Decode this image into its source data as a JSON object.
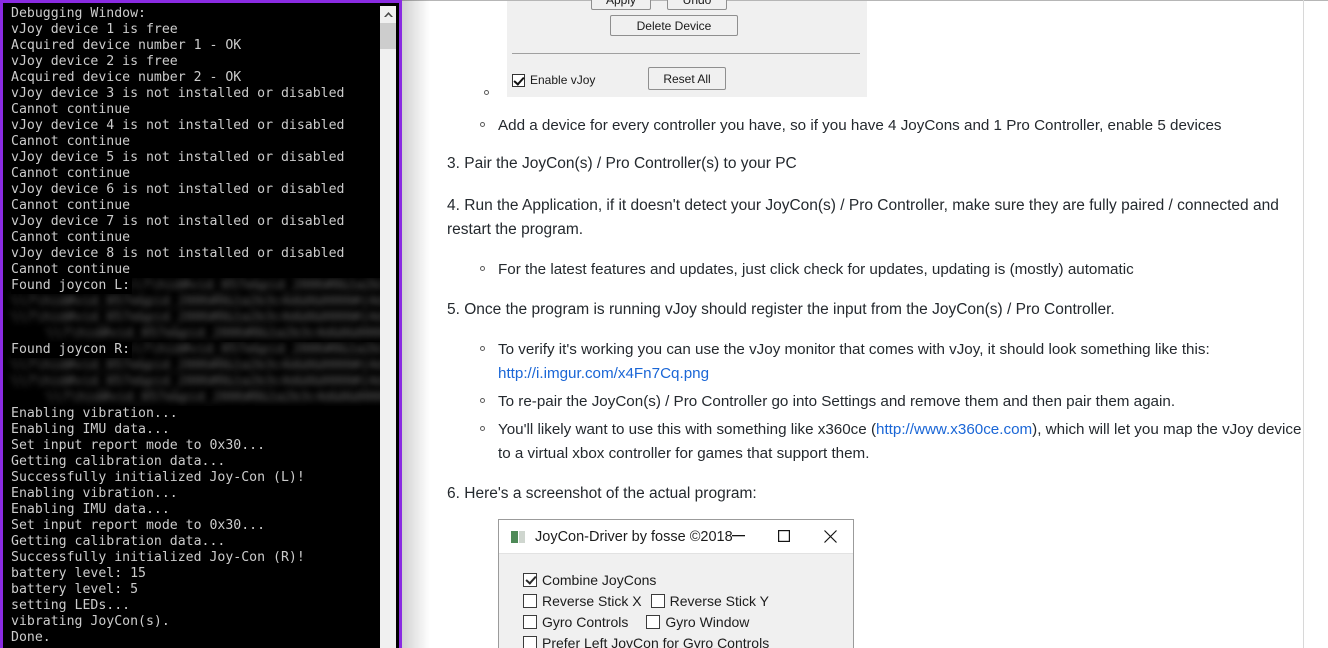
{
  "console": {
    "window_name": "Debugging Window",
    "lines": [
      "Debugging Window:",
      "vJoy device 1 is free",
      "Acquired device number 1 - OK",
      "vJoy device 2 is free",
      "Acquired device number 2 - OK",
      "vJoy device 3 is not installed or disabled",
      "Cannot continue",
      "vJoy device 4 is not installed or disabled",
      "Cannot continue",
      "vJoy device 5 is not installed or disabled",
      "Cannot continue",
      "vJoy device 6 is not installed or disabled",
      "Cannot continue",
      "vJoy device 7 is not installed or disabled",
      "Cannot continue",
      "vJoy device 8 is not installed or disabled",
      "Cannot continue"
    ],
    "found_left_label": "Found joycon L:",
    "found_right_label": "Found joycon R:",
    "redacted_placeholder": "\\\\?\\hid#vid_057e&pid_2006#8&1a2b3c4d&0&0000#{4d1e55b2}",
    "tail_lines": [
      "Enabling vibration...",
      "Enabling IMU data...",
      "Set input report mode to 0x30...",
      "Getting calibration data...",
      "Successfully initialized Joy-Con (L)!",
      "Enabling vibration...",
      "Enabling IMU data...",
      "Set input report mode to 0x30...",
      "Getting calibration data...",
      "Successfully initialized Joy-Con (R)!",
      "battery level: 15",
      "battery level: 5",
      "setting LEDs...",
      "vibrating JoyCon(s).",
      "Done."
    ],
    "border_color": "#8a2be2",
    "background_color": "#000000",
    "text_color": "#cccccc"
  },
  "vjoy_dialog": {
    "apply_label": "Apply",
    "undo_label": "Undo",
    "delete_device_label": "Delete Device",
    "reset_all_label": "Reset All",
    "enable_vjoy_label": "Enable vJoy",
    "enable_vjoy_checked": true
  },
  "document": {
    "items": [
      {
        "id": "bullet-add-device",
        "kind": "bullet",
        "text": "Add a device for every controller you have, so if you have 4 JoyCons and 1 Pro Controller, enable 5 devices"
      },
      {
        "id": "step-3",
        "kind": "numbered",
        "number": "3.",
        "text": "Pair the JoyCon(s) / Pro Controller(s) to your PC"
      },
      {
        "id": "step-4",
        "kind": "numbered",
        "number": "4.",
        "text": "Run the Application, if it doesn't detect your JoyCon(s) / Pro Controller, make sure they are fully paired / connected and restart the program."
      },
      {
        "id": "bullet-updates",
        "kind": "bullet",
        "text": "For the latest features and updates, just click check for updates, updating is (mostly) automatic"
      },
      {
        "id": "step-5",
        "kind": "numbered",
        "number": "5.",
        "text": "Once the program is running vJoy should register the input from the JoyCon(s) / Pro Controller."
      },
      {
        "id": "bullet-verify",
        "kind": "bullet",
        "text_before": "To verify it's working you can use the vJoy monitor that comes with vJoy, it should look something like this:",
        "link_text": "http://i.imgur.com/x4Fn7Cq.png"
      },
      {
        "id": "bullet-repair",
        "kind": "bullet",
        "text": "To re-pair the JoyCon(s) / Pro Controller go into Settings and remove them and then pair them again."
      },
      {
        "id": "bullet-x360ce",
        "kind": "bullet",
        "text_before": "You'll likely want to use this with something like x360ce (",
        "link_text": "http://www.x360ce.com",
        "text_after": "), which will let you map the vJoy device to a virtual xbox controller for games that support them."
      },
      {
        "id": "step-6",
        "kind": "numbered",
        "number": "6.",
        "text": "Here's a screenshot of the actual program:"
      }
    ],
    "link_color": "#1a66d6",
    "text_color": "#24292e"
  },
  "joycon_window": {
    "title": "JoyCon-Driver by fosse ©2018",
    "minimize_label": "—",
    "maximize_label": "□",
    "close_label": "✕",
    "checkboxes": [
      {
        "label": "Combine JoyCons",
        "checked": true
      },
      {
        "label": "Reverse Stick X",
        "checked": false
      },
      {
        "label": "Reverse Stick Y",
        "checked": false
      },
      {
        "label": "Gyro Controls",
        "checked": false
      },
      {
        "label": "Gyro Window",
        "checked": false
      },
      {
        "label": "Prefer Left JoyCon for Gyro Controls",
        "checked": false
      }
    ]
  }
}
